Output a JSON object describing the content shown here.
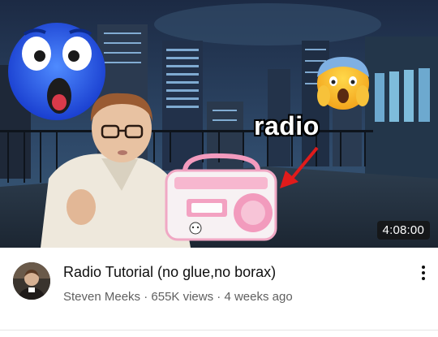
{
  "video": {
    "thumbnail_overlay_text": "radio",
    "duration": "4:08:00",
    "title": "Radio Tutorial (no glue,no borax)",
    "channel": "Steven Meeks",
    "separator": "·",
    "views": "655K views",
    "age": "4 weeks ago"
  },
  "icons": {
    "thumbnail_emoji_left": "flushed-blue-face-icon",
    "thumbnail_emoji_right": "face-screaming-in-fear-icon",
    "arrow": "red-arrow-icon",
    "menu": "more-vert-icon"
  },
  "colors": {
    "text_primary": "#0f0f0f",
    "text_secondary": "#606060",
    "duration_bg": "#141414",
    "arrow": "#e01b1b",
    "radio_pink": "#f4a7c3"
  }
}
